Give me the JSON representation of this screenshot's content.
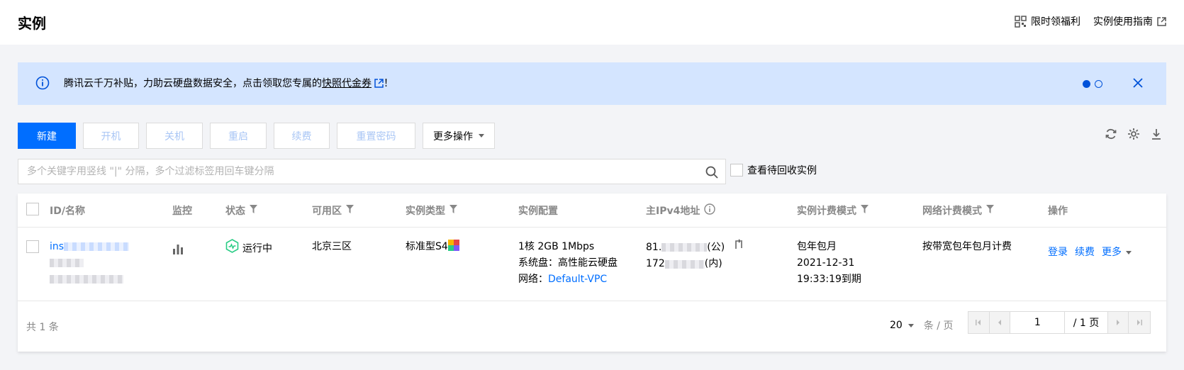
{
  "header": {
    "title": "实例",
    "links": [
      {
        "label": "限时领福利",
        "icon": "qrcode-icon"
      },
      {
        "label": "实例使用指南",
        "icon": "external-link-icon"
      }
    ]
  },
  "banner": {
    "text_before": "腾讯云千万补贴，力助云硬盘数据安全，点击领取您专属的",
    "link_text": "快照代金券",
    "text_after": "！",
    "slides": 2,
    "active_slide": 1
  },
  "toolbar": {
    "new": "新建",
    "start": "开机",
    "stop": "关机",
    "restart": "重启",
    "renew": "续费",
    "reset_password": "重置密码",
    "more": "更多操作"
  },
  "search": {
    "placeholder": "多个关键字用竖线 \"|\" 分隔，多个过滤标签用回车键分隔",
    "recycle_label": "查看待回收实例"
  },
  "table": {
    "columns": {
      "id_name": "ID/名称",
      "monitor": "监控",
      "status": "状态",
      "zone": "可用区",
      "type": "实例类型",
      "config": "实例配置",
      "ipv4": "主IPv4地址",
      "billing": "实例计费模式",
      "net_billing": "网络计费模式",
      "actions": "操作"
    },
    "rows": [
      {
        "id_prefix": "ins",
        "status": "运行中",
        "zone": "北京三区",
        "type": "标准型S4",
        "config_line1": "1核 2GB 1Mbps",
        "config_line2": "系统盘：高性能云硬盘",
        "config_line3_label": "网络：",
        "config_vpc": "Default-VPC",
        "ip_public_prefix": "81.",
        "ip_public_suffix": "(公)",
        "ip_private_prefix": "172",
        "ip_private_suffix": "(内)",
        "billing_mode": "包年包月",
        "expire_date": "2021-12-31",
        "expire_time": "19:33:19到期",
        "net_billing": "按带宽包年包月计费",
        "action_login": "登录",
        "action_renew": "续费",
        "action_more": "更多"
      }
    ]
  },
  "pagination": {
    "total": "共 1 条",
    "page_size": "20",
    "page_size_unit": "条 / 页",
    "current_page": "1",
    "total_pages": "/ 1 页"
  },
  "colors": {
    "primary": "#006eff",
    "banner_bg": "#d4e5ff",
    "status_green": "#29cc85"
  }
}
